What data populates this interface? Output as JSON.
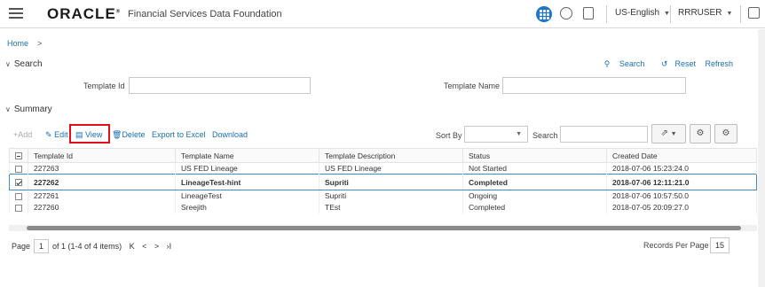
{
  "header": {
    "logo": "ORACLE",
    "logo_mark": "®",
    "app_title": "Financial Services Data Foundation",
    "language": "US-English",
    "user": "RRRUSER"
  },
  "breadcrumb": {
    "home": "Home",
    "sep": ">"
  },
  "search": {
    "section_title": "Search",
    "toggle_glyph": "∨",
    "search_link": "Search",
    "reset_link": "Reset",
    "refresh_link": "Refresh",
    "template_id_label": "Template Id",
    "template_id_value": "",
    "template_name_label": "Template Name",
    "template_name_value": ""
  },
  "summary": {
    "section_title": "Summary",
    "toolbar": {
      "add": "Add",
      "edit": "Edit",
      "view": "View",
      "delete": "Delete",
      "export": "Export to Excel",
      "download": "Download",
      "sort_by_label": "Sort By",
      "sort_by_value": "",
      "search_label": "Search",
      "search_value": ""
    },
    "columns": [
      "Template Id",
      "Template Name",
      "Template Description",
      "Status",
      "Created Date"
    ],
    "rows": [
      {
        "id": "227263",
        "name": "US FED Lineage",
        "desc": "US FED Lineage",
        "status": "Not Started",
        "created": "2018-07-06 15:23:24.0",
        "checked": false
      },
      {
        "id": "227262",
        "name": "LineageTest-hint",
        "desc": "Supriti",
        "status": "Completed",
        "created": "2018-07-06 12:11:21.0",
        "checked": true
      },
      {
        "id": "227261",
        "name": "LineageTest",
        "desc": "Supriti",
        "status": "Ongoing",
        "created": "2018-07-06 10:57:50.0",
        "checked": false
      },
      {
        "id": "227260",
        "name": "Sreejith",
        "desc": "TEst",
        "status": "Completed",
        "created": "2018-07-05 20:09:27.0",
        "checked": false
      }
    ],
    "pager": {
      "page_label": "Page",
      "page": "1",
      "of_text": "of 1 (1-4 of 4 items)",
      "first": "K",
      "prev": "<",
      "next": ">",
      "last": "›I",
      "records_per_page_label": "Records Per Page",
      "records_per_page": "15"
    }
  }
}
